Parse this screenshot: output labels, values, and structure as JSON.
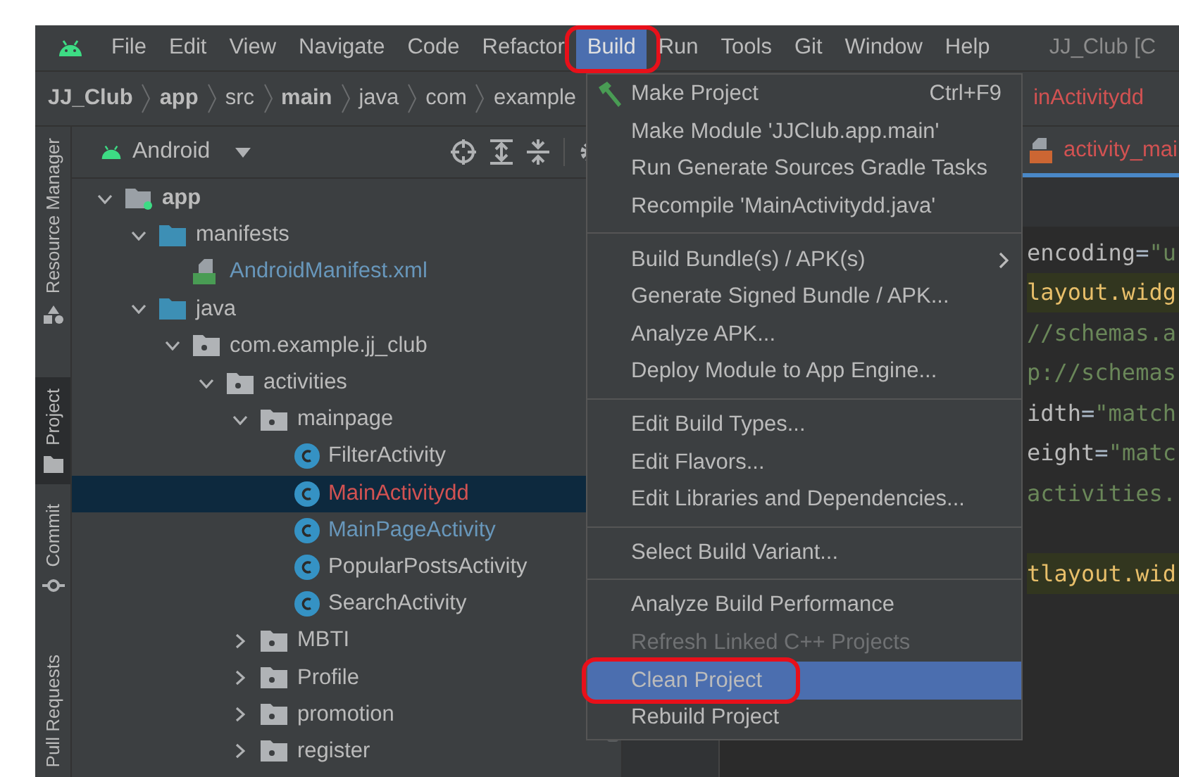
{
  "menu_bar": {
    "items": [
      {
        "label": "File",
        "selected": false
      },
      {
        "label": "Edit",
        "selected": false
      },
      {
        "label": "View",
        "selected": false
      },
      {
        "label": "Navigate",
        "selected": false
      },
      {
        "label": "Code",
        "selected": false
      },
      {
        "label": "Refactor",
        "selected": false
      },
      {
        "label": "Build",
        "selected": true
      },
      {
        "label": "Run",
        "selected": false
      },
      {
        "label": "Tools",
        "selected": false
      },
      {
        "label": "Git",
        "selected": false
      },
      {
        "label": "Window",
        "selected": false
      },
      {
        "label": "Help",
        "selected": false
      }
    ],
    "window_title": "JJ_Club [C"
  },
  "breadcrumb": [
    {
      "label": "JJ_Club",
      "bold": true
    },
    {
      "label": "app",
      "bold": true
    },
    {
      "label": "src",
      "bold": false
    },
    {
      "label": "main",
      "bold": true
    },
    {
      "label": "java",
      "bold": false
    },
    {
      "label": "com",
      "bold": false
    },
    {
      "label": "example",
      "bold": false
    }
  ],
  "breadcrumb_tail": "inActivitydd",
  "tool_strip": [
    {
      "label": "Resource Manager",
      "kind": "resources",
      "selected": false
    },
    {
      "label": "Project",
      "kind": "project",
      "selected": true
    },
    {
      "label": "Commit",
      "kind": "commit",
      "selected": false
    },
    {
      "label": "Pull Requests",
      "kind": "pull-requests",
      "selected": false
    }
  ],
  "project_panel": {
    "view": "Android",
    "tree": [
      {
        "label": "app",
        "kind": "module",
        "bold": true,
        "expanded": true,
        "children": [
          {
            "label": "manifests",
            "kind": "folder",
            "expanded": true,
            "children": [
              {
                "label": "AndroidManifest.xml",
                "kind": "manifest",
                "color": "#6897bb",
                "selected": false
              }
            ]
          },
          {
            "label": "java",
            "kind": "folder",
            "expanded": true,
            "children": [
              {
                "label": "com.example.jj_club",
                "kind": "package",
                "expanded": true,
                "children": [
                  {
                    "label": "activities",
                    "kind": "package",
                    "expanded": true,
                    "children": [
                      {
                        "label": "mainpage",
                        "kind": "package",
                        "expanded": true,
                        "children": [
                          {
                            "label": "FilterActivity",
                            "kind": "class",
                            "color": "#bbbbbb",
                            "selected": false
                          },
                          {
                            "label": "MainActivitydd",
                            "kind": "class",
                            "color": "#d25252",
                            "selected": true
                          },
                          {
                            "label": "MainPageActivity",
                            "kind": "class",
                            "color": "#6897bb",
                            "selected": false
                          },
                          {
                            "label": "PopularPostsActivity",
                            "kind": "class",
                            "color": "#bbbbbb",
                            "selected": false
                          },
                          {
                            "label": "SearchActivity",
                            "kind": "class",
                            "color": "#bbbbbb",
                            "selected": false
                          }
                        ]
                      },
                      {
                        "label": "MBTI",
                        "kind": "package",
                        "expanded": false
                      },
                      {
                        "label": "Profile",
                        "kind": "package",
                        "expanded": false
                      },
                      {
                        "label": "promotion",
                        "kind": "package",
                        "expanded": false
                      },
                      {
                        "label": "register",
                        "kind": "package",
                        "expanded": false
                      }
                    ]
                  }
                ]
              }
            ]
          }
        ]
      }
    ]
  },
  "editor": {
    "tab": "activity_mai",
    "code_lines": [
      {
        "highlighted": false,
        "parts": [
          {
            "text": "encoding",
            "kind": "attr"
          },
          {
            "text": "=",
            "kind": "punct"
          },
          {
            "text": "\"u",
            "kind": "string"
          }
        ]
      },
      {
        "highlighted": true,
        "parts": [
          {
            "text": "layout.widg",
            "kind": "tag"
          }
        ]
      },
      {
        "highlighted": false,
        "parts": [
          {
            "text": "//schemas.a",
            "kind": "string"
          }
        ]
      },
      {
        "highlighted": false,
        "parts": [
          {
            "text": "p://schemas",
            "kind": "string"
          }
        ]
      },
      {
        "highlighted": false,
        "parts": [
          {
            "text": "idth",
            "kind": "attr"
          },
          {
            "text": "=",
            "kind": "punct"
          },
          {
            "text": "\"match",
            "kind": "string"
          }
        ]
      },
      {
        "highlighted": false,
        "parts": [
          {
            "text": "eight",
            "kind": "attr"
          },
          {
            "text": "=",
            "kind": "punct"
          },
          {
            "text": "\"matc",
            "kind": "string"
          }
        ]
      },
      {
        "highlighted": false,
        "parts": [
          {
            "text": "activities.",
            "kind": "string"
          }
        ]
      },
      {
        "highlighted": true,
        "blank_before": true,
        "parts": [
          {
            "text": "tlayout.wid",
            "kind": "tag"
          }
        ]
      }
    ]
  },
  "build_menu": {
    "groups": [
      [
        {
          "label": "Make Project",
          "shortcut": "Ctrl+F9",
          "has_icon": true,
          "selected": false,
          "disabled": false
        },
        {
          "label": "Make Module 'JJClub.app.main'",
          "selected": false,
          "disabled": false
        },
        {
          "label": "Run Generate Sources Gradle Tasks",
          "selected": false,
          "disabled": false
        },
        {
          "label": "Recompile 'MainActivitydd.java'",
          "selected": false,
          "disabled": false
        }
      ],
      [
        {
          "label": "Build Bundle(s) / APK(s)",
          "submenu": true,
          "selected": false,
          "disabled": false
        },
        {
          "label": "Generate Signed Bundle / APK...",
          "selected": false,
          "disabled": false
        },
        {
          "label": "Analyze APK...",
          "selected": false,
          "disabled": false
        },
        {
          "label": "Deploy Module to App Engine...",
          "selected": false,
          "disabled": false
        }
      ],
      [
        {
          "label": "Edit Build Types...",
          "selected": false,
          "disabled": false
        },
        {
          "label": "Edit Flavors...",
          "selected": false,
          "disabled": false
        },
        {
          "label": "Edit Libraries and Dependencies...",
          "selected": false,
          "disabled": false
        }
      ],
      [
        {
          "label": "Select Build Variant...",
          "selected": false,
          "disabled": false
        }
      ],
      [
        {
          "label": "Analyze Build Performance",
          "selected": false,
          "disabled": false
        },
        {
          "label": "Refresh Linked C++ Projects",
          "selected": false,
          "disabled": true
        },
        {
          "label": "Clean Project",
          "selected": true,
          "disabled": false
        },
        {
          "label": "Rebuild Project",
          "selected": false,
          "disabled": false
        }
      ]
    ]
  }
}
